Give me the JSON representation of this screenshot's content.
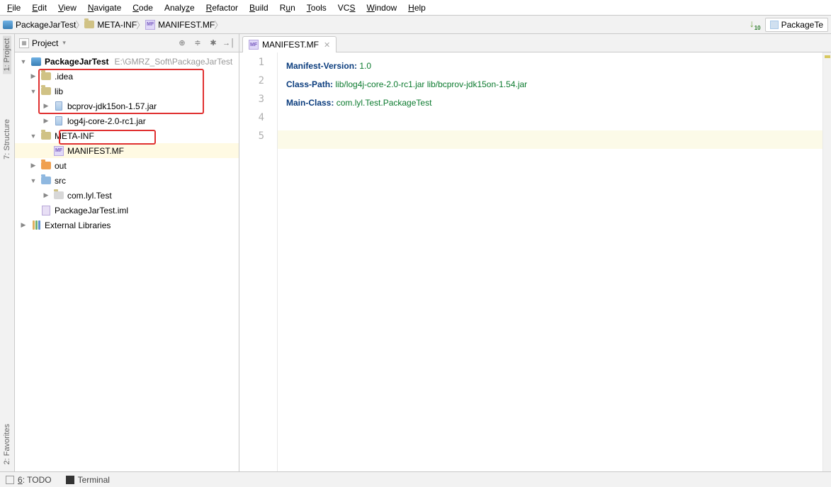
{
  "menu": {
    "items": [
      "File",
      "Edit",
      "View",
      "Navigate",
      "Code",
      "Analyze",
      "Refactor",
      "Build",
      "Run",
      "Tools",
      "VCS",
      "Window",
      "Help"
    ]
  },
  "breadcrumb": {
    "items": [
      "PackageJarTest",
      "META-INF",
      "MANIFEST.MF"
    ]
  },
  "runconfig": {
    "label": "PackageTe"
  },
  "panel": {
    "title": "Project",
    "root": {
      "name": "PackageJarTest",
      "hint": "E:\\GMRZ_Soft\\PackageJarTest"
    },
    "idea": ".idea",
    "lib": {
      "name": "lib",
      "items": [
        "bcprov-jdk15on-1.57.jar",
        "log4j-core-2.0-rc1.jar"
      ]
    },
    "metainf": {
      "name": "META-INF",
      "items": [
        "MANIFEST.MF"
      ]
    },
    "out": "out",
    "src": {
      "name": "src",
      "pkg": "com.lyl.Test"
    },
    "iml": "PackageJarTest.iml",
    "extlibs": "External Libraries"
  },
  "tabs": {
    "open": [
      "MANIFEST.MF"
    ]
  },
  "editor": {
    "l1_k": "Manifest-Version:",
    "l1_v": " 1.0",
    "l2_k": "Class-Path:",
    "l2_v": " lib/log4j-core-2.0-rc1.jar lib/bcprov-jdk15on-1.54.jar",
    "l3_k": "Main-Class:",
    "l3_v": " com.lyl.Test.PackageTest",
    "line_numbers": [
      "1",
      "2",
      "3",
      "4",
      "5"
    ]
  },
  "leftgutter": {
    "project": "1: Project",
    "structure": "7: Structure",
    "favorites": "2: Favorites"
  },
  "bottom": {
    "todo": "6: TODO",
    "terminal": "Terminal"
  }
}
